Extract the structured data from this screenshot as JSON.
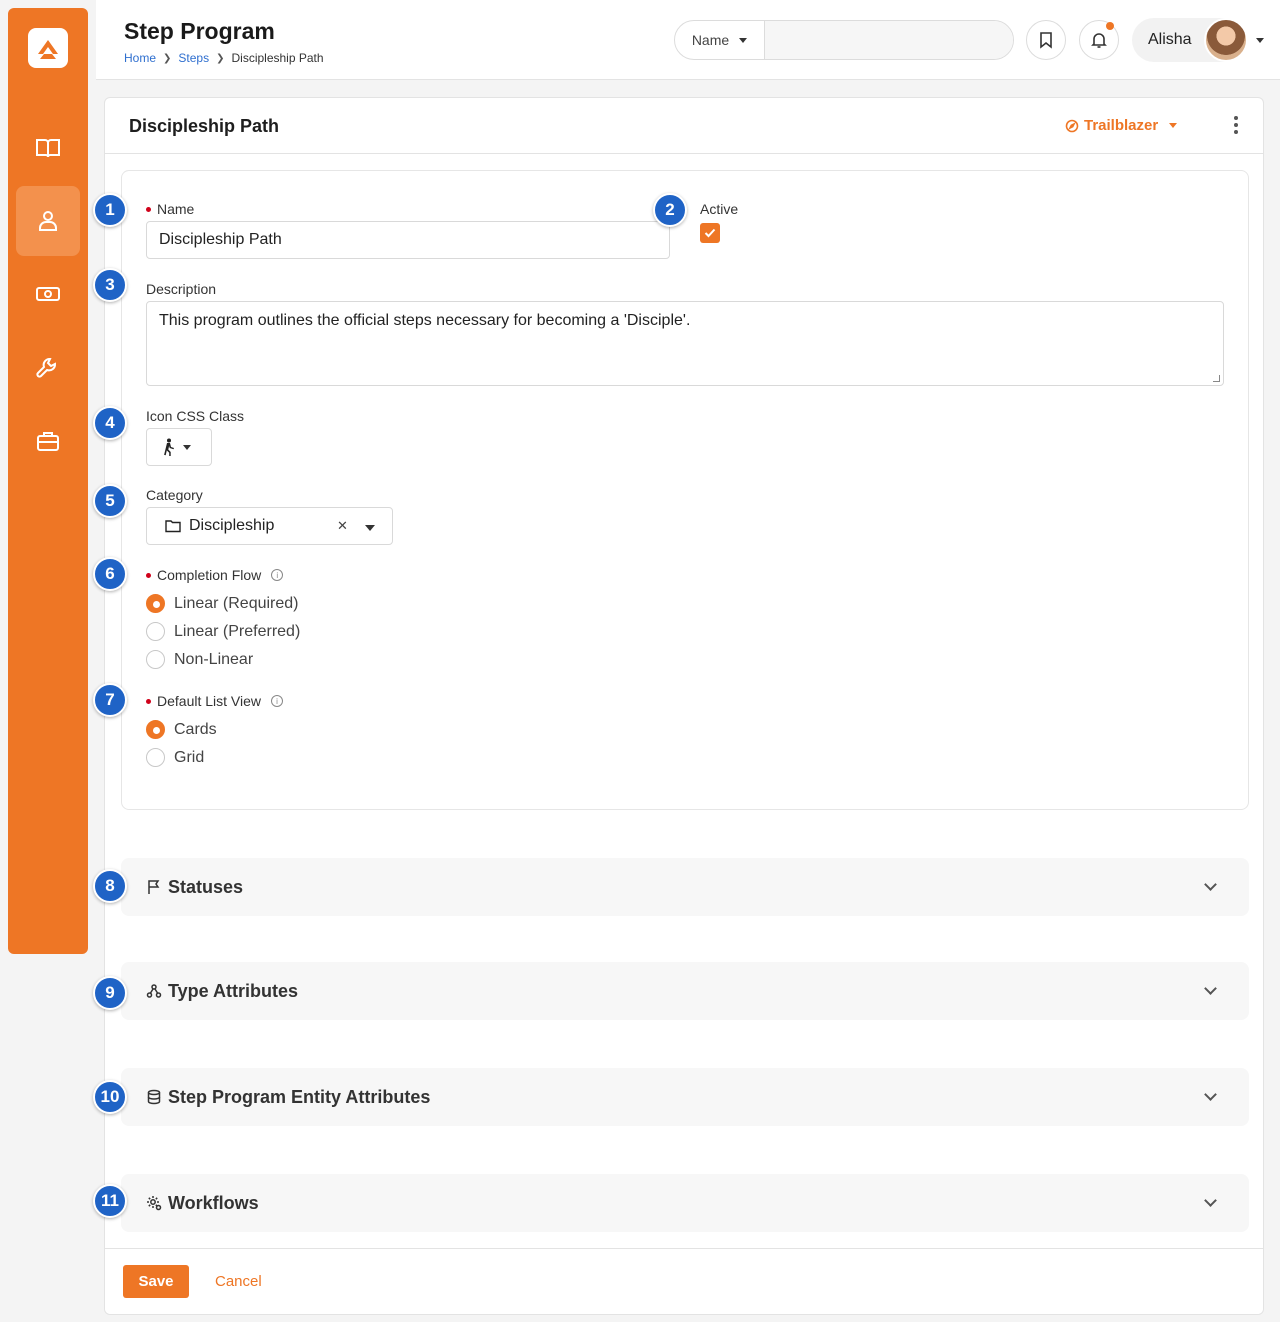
{
  "header": {
    "title": "Step Program",
    "breadcrumb": [
      {
        "label": "Home"
      },
      {
        "label": "Steps"
      },
      {
        "label": "Discipleship Path"
      }
    ],
    "search": {
      "scope": "Name",
      "placeholder": ""
    },
    "user": {
      "name": "Alisha"
    }
  },
  "sidebar": {
    "items": [
      {
        "icon": "book-icon"
      },
      {
        "icon": "person-icon",
        "active": true
      },
      {
        "icon": "money-icon"
      },
      {
        "icon": "wrench-icon"
      },
      {
        "icon": "briefcase-icon"
      }
    ]
  },
  "card": {
    "title": "Discipleship Path",
    "badge": "Trailblazer"
  },
  "form": {
    "name": {
      "label": "Name",
      "value": "Discipleship Path",
      "required": true
    },
    "active": {
      "label": "Active",
      "checked": true
    },
    "description": {
      "label": "Description",
      "value": "This program outlines the official steps necessary for becoming a 'Disciple'."
    },
    "icon_css_class": {
      "label": "Icon CSS Class",
      "icon": "walking-person-icon"
    },
    "category": {
      "label": "Category",
      "value": "Discipleship"
    },
    "completion_flow": {
      "label": "Completion Flow",
      "required": true,
      "options": [
        "Linear (Required)",
        "Linear (Preferred)",
        "Non-Linear"
      ],
      "selected": "Linear (Required)"
    },
    "default_list_view": {
      "label": "Default List View",
      "required": true,
      "options": [
        "Cards",
        "Grid"
      ],
      "selected": "Cards"
    }
  },
  "sections": [
    {
      "label": "Statuses",
      "icon": "flag-icon"
    },
    {
      "label": "Type Attributes",
      "icon": "attributes-icon"
    },
    {
      "label": "Step Program Entity Attributes",
      "icon": "database-icon"
    },
    {
      "label": "Workflows",
      "icon": "cog-icon"
    }
  ],
  "footer": {
    "save_label": "Save",
    "cancel_label": "Cancel"
  },
  "markers": [
    "1",
    "2",
    "3",
    "4",
    "5",
    "6",
    "7",
    "8",
    "9",
    "10",
    "11"
  ],
  "colors": {
    "accent": "#ee7625",
    "marker": "#1f63c6",
    "link": "#2f6fcf"
  }
}
